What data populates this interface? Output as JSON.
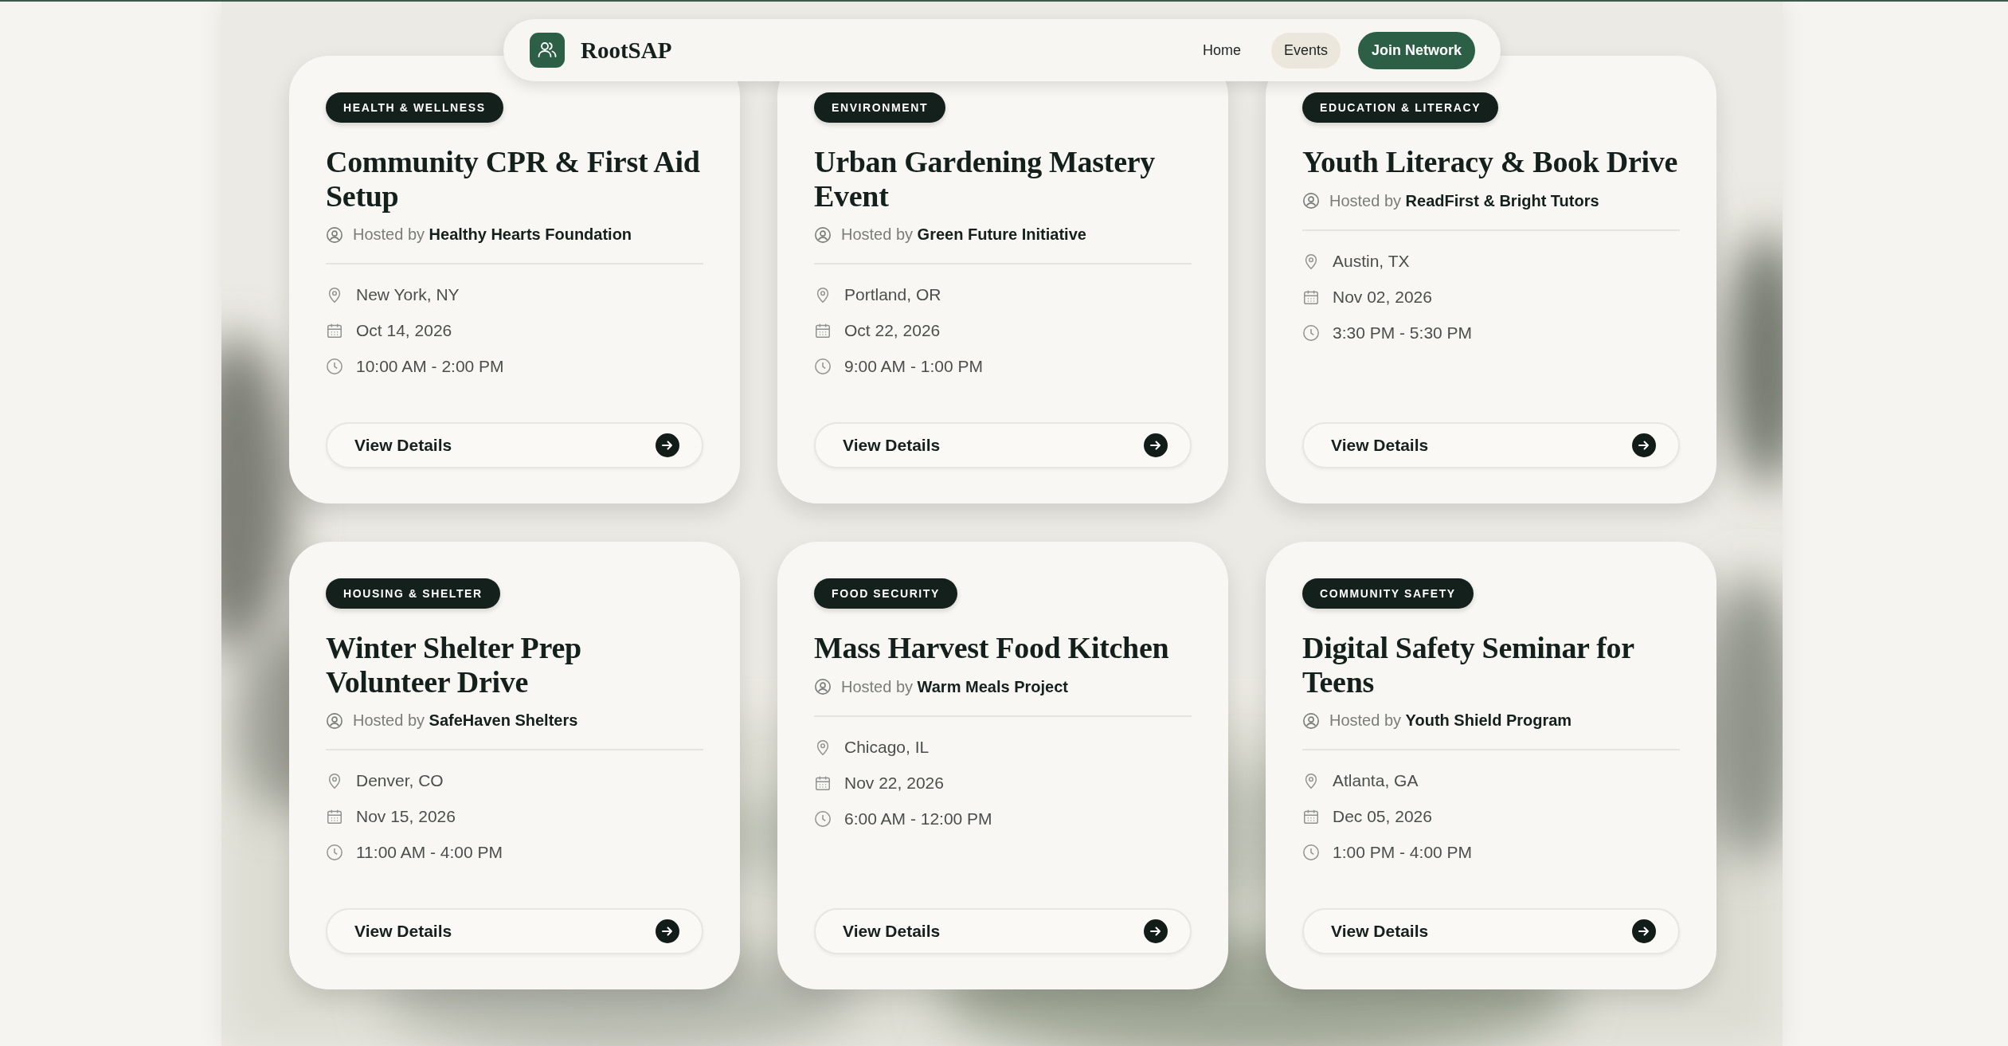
{
  "nav": {
    "brand": "RootSAP",
    "items": [
      {
        "label": "Home",
        "selected": false
      },
      {
        "label": "Events",
        "selected": true
      }
    ],
    "cta": "Join Network"
  },
  "events": [
    {
      "tag": "HEALTH & WELLNESS",
      "title": "Community CPR & First Aid Setup",
      "host": "Hosted by **Healthy Hearts Foundation**",
      "location": "New York, NY",
      "date": "Oct 14, 2026",
      "time": "10:00 AM - 2:00 PM",
      "button": "View Details"
    },
    {
      "tag": "ENVIRONMENT",
      "title": "Urban Gardening Mastery Event",
      "host": "Hosted by **Green Future Initiative**",
      "location": "Portland, OR",
      "date": "Oct 22, 2026",
      "time": "9:00 AM - 1:00 PM",
      "button": "View Details"
    },
    {
      "tag": "EDUCATION & LITERACY",
      "title": "Youth Literacy & Book Drive",
      "host": "Hosted by **ReadFirst & Bright Tutors**",
      "location": "Austin, TX",
      "date": "Nov 02, 2026",
      "time": "3:30 PM - 5:30 PM",
      "button": "View Details"
    },
    {
      "tag": "HOUSING & SHELTER",
      "title": "Winter Shelter Prep Volunteer Drive",
      "host": "Hosted by **SafeHaven Shelters**",
      "location": "Denver, CO",
      "date": "Nov 15, 2026",
      "time": "11:00 AM - 4:00 PM",
      "button": "View Details"
    },
    {
      "tag": "FOOD SECURITY",
      "title": "Mass Harvest Food Kitchen",
      "host": "Hosted by **Warm Meals Project**",
      "location": "Chicago, IL",
      "date": "Nov 22, 2026",
      "time": "6:00 AM - 12:00 PM",
      "button": "View Details"
    },
    {
      "tag": "COMMUNITY SAFETY",
      "title": "Digital Safety Seminar for Teens",
      "host": "Hosted by **Youth Shield Program**",
      "location": "Atlanta, GA",
      "date": "Dec 05, 2026",
      "time": "1:00 PM - 4:00 PM",
      "button": "View Details"
    }
  ]
}
